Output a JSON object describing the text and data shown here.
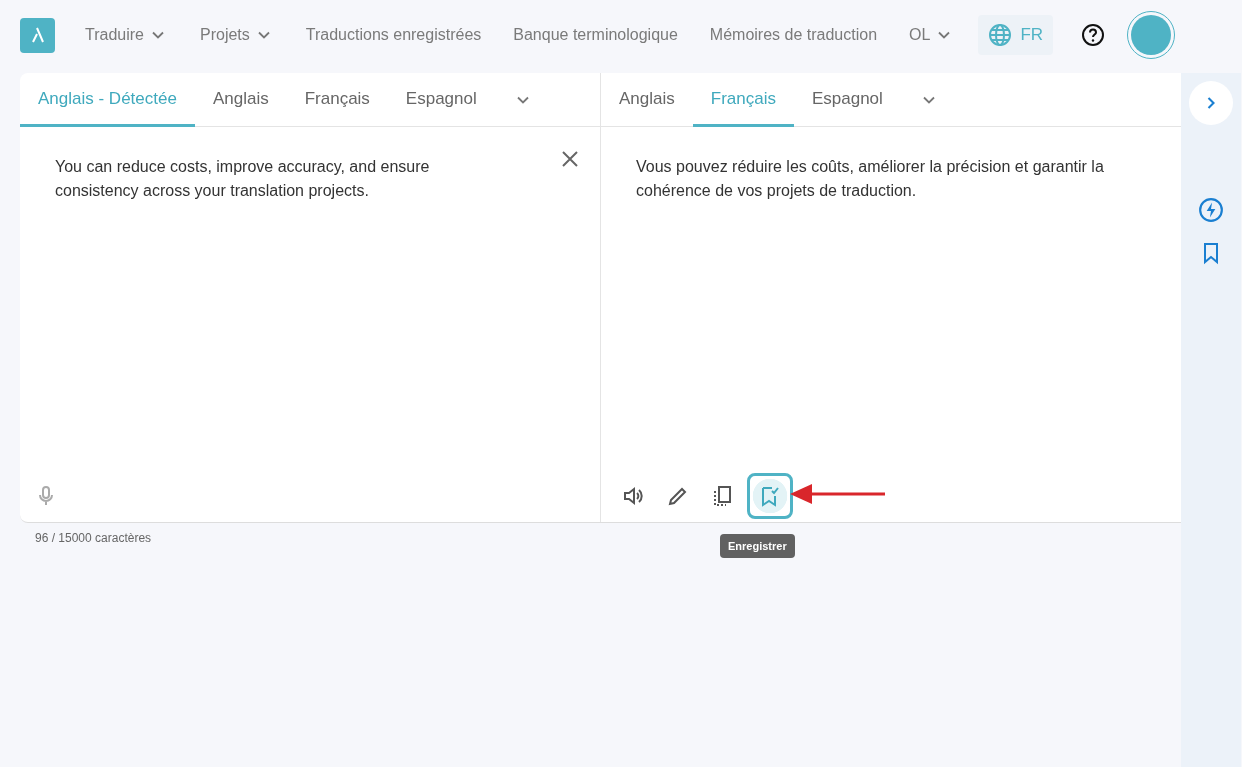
{
  "nav": {
    "items": [
      {
        "label": "Traduire",
        "dropdown": true
      },
      {
        "label": "Projets",
        "dropdown": true
      },
      {
        "label": "Traductions enregistrées",
        "dropdown": false
      },
      {
        "label": "Banque terminologique",
        "dropdown": false
      },
      {
        "label": "Mémoires de traduction",
        "dropdown": false
      },
      {
        "label": "OL",
        "dropdown": true
      }
    ],
    "language": "FR"
  },
  "source": {
    "tabs": [
      {
        "label": "Anglais - Détectée",
        "selected": true
      },
      {
        "label": "Anglais",
        "selected": false
      },
      {
        "label": "Français",
        "selected": false
      },
      {
        "label": "Espagnol",
        "selected": false
      }
    ],
    "text": "You can reduce costs, improve accuracy, and ensure consistency across your translation projects.",
    "counter": "96 / 15000 caractères"
  },
  "target": {
    "tabs": [
      {
        "label": "Anglais",
        "selected": false
      },
      {
        "label": "Français",
        "selected": true
      },
      {
        "label": "Espagnol",
        "selected": false
      }
    ],
    "text": "Vous pouvez réduire les coûts, améliorer la précision et garantir la cohérence de vos projets de traduction.",
    "actions": [
      {
        "kind": "speaker",
        "highlighted": false
      },
      {
        "kind": "pencil",
        "highlighted": false
      },
      {
        "kind": "copy",
        "highlighted": false
      },
      {
        "kind": "bookmark",
        "highlighted": true
      }
    ],
    "tooltip": "Enregistrer"
  }
}
